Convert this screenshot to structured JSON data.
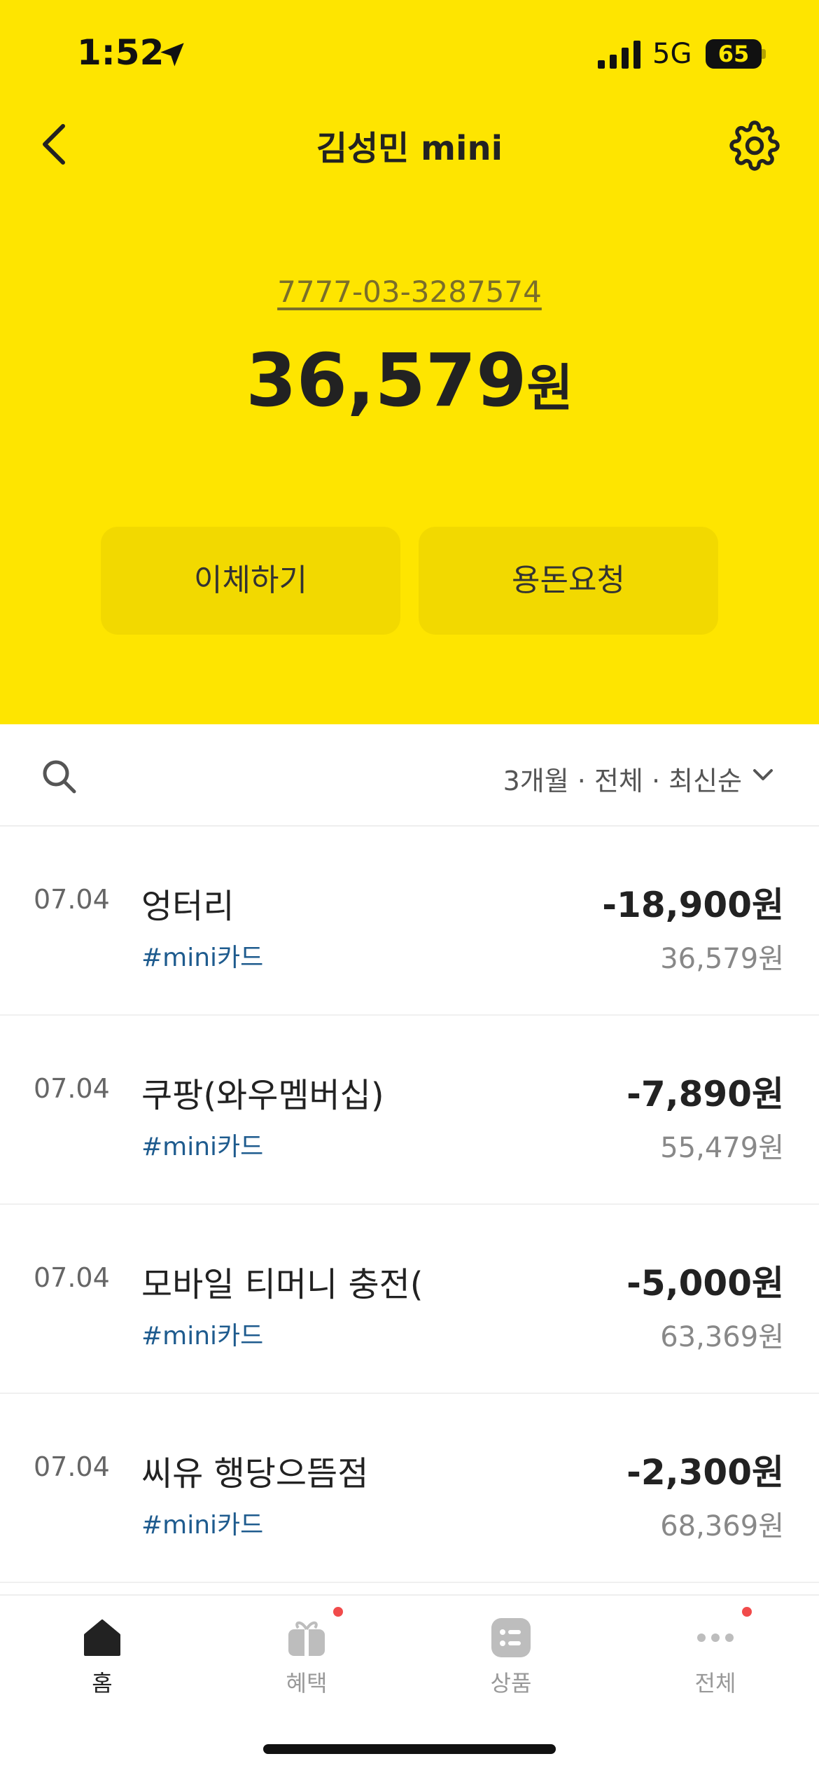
{
  "status_bar": {
    "time": "1:52",
    "network": "5G",
    "battery": "65"
  },
  "header": {
    "title": "김성민 mini"
  },
  "account": {
    "number": "7777-03-3287574",
    "balance_amount": "36,579",
    "balance_unit": "원"
  },
  "actions": {
    "transfer_label": "이체하기",
    "allowance_label": "용돈요청"
  },
  "filter": {
    "label": "3개월 · 전체 · 최신순"
  },
  "transactions": [
    {
      "date": "07.04",
      "name": "엉터리",
      "tag": "#mini카드",
      "amount": "-18,900원",
      "balance": "36,579원"
    },
    {
      "date": "07.04",
      "name": "쿠팡(와우멤버십)",
      "tag": "#mini카드",
      "amount": "-7,890원",
      "balance": "55,479원"
    },
    {
      "date": "07.04",
      "name": "모바일 티머니 충전(",
      "tag": "#mini카드",
      "amount": "-5,000원",
      "balance": "63,369원"
    },
    {
      "date": "07.04",
      "name": "씨유 행당으뜸점",
      "tag": "#mini카드",
      "amount": "-2,300원",
      "balance": "68,369원"
    }
  ],
  "nav": {
    "items": [
      {
        "label": "홈",
        "icon": "home-icon",
        "active": true
      },
      {
        "label": "혜택",
        "icon": "gift-icon",
        "badge": true
      },
      {
        "label": "상품",
        "icon": "list-icon"
      },
      {
        "label": "전체",
        "icon": "more-icon",
        "badge": true
      }
    ]
  },
  "colors": {
    "brand_yellow": "#FEE500",
    "button_yellow": "#F2D900",
    "tag_blue": "#1e5b8e",
    "badge_red": "#f14b4b"
  }
}
